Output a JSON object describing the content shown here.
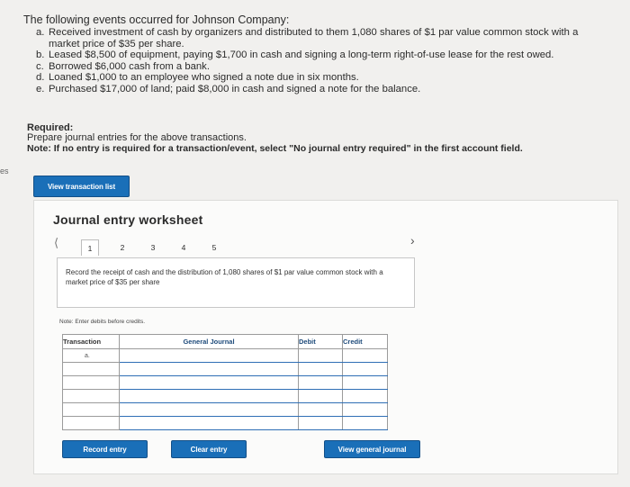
{
  "intro": "The following events occurred for Johnson Company:",
  "events": [
    {
      "letter": "a.",
      "text": "Received investment of cash by organizers and distributed to them 1,080 shares of $1 par value common stock with a market price of $35 per share."
    },
    {
      "letter": "b.",
      "text": "Leased $8,500 of equipment, paying $1,700 in cash and signing a long-term right-of-use lease for the rest owed."
    },
    {
      "letter": "c.",
      "text": "Borrowed $6,000 cash from a bank."
    },
    {
      "letter": "d.",
      "text": "Loaned $1,000 to an employee who signed a note due in six months."
    },
    {
      "letter": "e.",
      "text": "Purchased $17,000 of land; paid $8,000 in cash and signed a note for the balance."
    }
  ],
  "required_label": "Required:",
  "prepare_text": "Prepare journal entries for the above transactions.",
  "note_text": "Note: If no entry is required for a transaction/event, select \"No journal entry required\" in the first account field.",
  "left_edge_text": "es",
  "view_transaction_list": "View transaction list",
  "worksheet": {
    "title": "Journal entry worksheet",
    "tabs": [
      "1",
      "2",
      "3",
      "4",
      "5"
    ],
    "active_tab": "1",
    "instruction": "Record the receipt of cash and the distribution of 1,080 shares of $1 par value common stock with a market price of $35 per share",
    "enter_note": "Note: Enter debits before credits.",
    "table": {
      "headers": {
        "transaction": "Transaction",
        "general_journal": "General Journal",
        "debit": "Debit",
        "credit": "Credit"
      },
      "rows": [
        {
          "transaction": "a.",
          "account": "",
          "debit": "",
          "credit": ""
        },
        {
          "transaction": "",
          "account": "",
          "debit": "",
          "credit": ""
        },
        {
          "transaction": "",
          "account": "",
          "debit": "",
          "credit": ""
        },
        {
          "transaction": "",
          "account": "",
          "debit": "",
          "credit": ""
        },
        {
          "transaction": "",
          "account": "",
          "debit": "",
          "credit": ""
        },
        {
          "transaction": "",
          "account": "",
          "debit": "",
          "credit": ""
        }
      ]
    },
    "buttons": {
      "record": "Record entry",
      "clear": "Clear entry",
      "view_general_journal": "View general journal"
    }
  },
  "colors": {
    "button_blue": "#1a6fb8",
    "row_line_blue": "#2f6fb5"
  }
}
